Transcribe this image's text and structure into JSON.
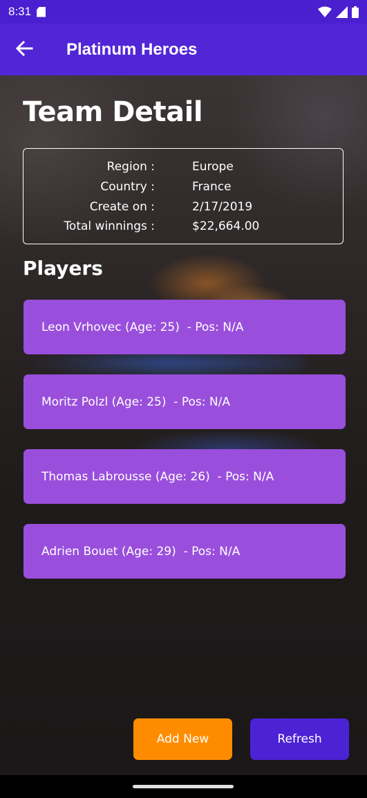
{
  "status_bar": {
    "time": "8:31"
  },
  "app_bar": {
    "title": "Platinum Heroes"
  },
  "page": {
    "title": "Team Detail"
  },
  "team_info": [
    {
      "label": "Region :",
      "value": "Europe"
    },
    {
      "label": "Country :",
      "value": "France"
    },
    {
      "label": "Create on :",
      "value": "2/17/2019"
    },
    {
      "label": "Total winnings :",
      "value": "$22,664.00"
    }
  ],
  "players_section": {
    "title": "Players"
  },
  "players": [
    {
      "text": "Leon Vrhovec (Age: 25)  - Pos: N/A"
    },
    {
      "text": "Moritz Polzl (Age: 25)  - Pos: N/A"
    },
    {
      "text": "Thomas Labrousse (Age: 26)  - Pos: N/A"
    },
    {
      "text": "Adrien Bouet (Age: 29)  - Pos: N/A"
    }
  ],
  "actions": {
    "add_label": "Add New",
    "refresh_label": "Refresh"
  },
  "colors": {
    "status_bar": "#4a1fd0",
    "app_bar": "#5226d6",
    "player_card": "#9a4fdc",
    "add_button": "#ff8c00",
    "refresh_button": "#4b22d4"
  },
  "icons": {
    "back": "arrow-left-icon",
    "sd_card": "sd-card-icon",
    "wifi": "wifi-icon",
    "signal": "signal-icon",
    "battery": "battery-icon"
  }
}
